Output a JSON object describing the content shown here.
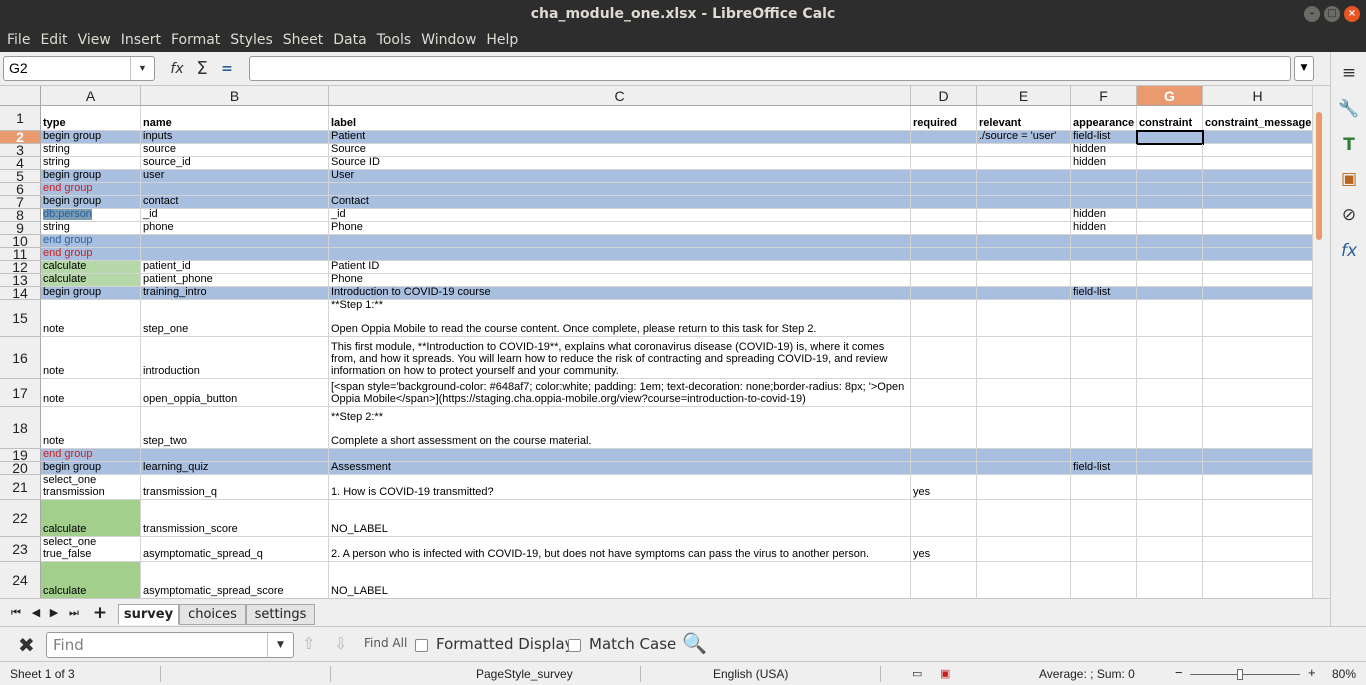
{
  "window": {
    "title": "cha_module_one.xlsx - LibreOffice Calc",
    "minimize": "–",
    "maximize": "□",
    "close": "×"
  },
  "menu": [
    "File",
    "Edit",
    "View",
    "Insert",
    "Format",
    "Styles",
    "Sheet",
    "Data",
    "Tools",
    "Window",
    "Help"
  ],
  "formula_bar": {
    "cell_ref": "G2",
    "content": ""
  },
  "columns": [
    {
      "id": "A",
      "label": "A"
    },
    {
      "id": "B",
      "label": "B"
    },
    {
      "id": "C",
      "label": "C"
    },
    {
      "id": "D",
      "label": "D"
    },
    {
      "id": "E",
      "label": "E"
    },
    {
      "id": "F",
      "label": "F"
    },
    {
      "id": "G",
      "label": "G",
      "selected": true
    },
    {
      "id": "H",
      "label": "H"
    }
  ],
  "rows": [
    {
      "num": "1",
      "cells": [
        "type",
        "name",
        "label",
        "required",
        "relevant",
        "appearance",
        "constraint",
        "constraint_message"
      ]
    },
    {
      "num": "2",
      "cells": [
        "begin group",
        "inputs",
        "Patient",
        "",
        "./source = 'user'",
        "field-list",
        "",
        ""
      ],
      "selected": true
    },
    {
      "num": "3",
      "cells": [
        "string",
        "source",
        "Source",
        "",
        "",
        "hidden",
        "",
        ""
      ]
    },
    {
      "num": "4",
      "cells": [
        "string",
        "source_id",
        "Source ID",
        "",
        "",
        "hidden",
        "",
        ""
      ]
    },
    {
      "num": "5",
      "cells": [
        "begin group",
        "user",
        "User",
        "",
        "",
        "",
        "",
        ""
      ]
    },
    {
      "num": "6",
      "cells": [
        "end group",
        "",
        "",
        "",
        "",
        "",
        "",
        ""
      ]
    },
    {
      "num": "7",
      "cells": [
        "begin group",
        "contact",
        "Contact",
        "",
        "",
        "",
        "",
        ""
      ]
    },
    {
      "num": "8",
      "cells": [
        "db:person",
        "_id",
        "_id",
        "",
        "",
        "hidden",
        "",
        ""
      ]
    },
    {
      "num": "9",
      "cells": [
        "string",
        "phone",
        "Phone",
        "",
        "",
        "hidden",
        "",
        ""
      ]
    },
    {
      "num": "10",
      "cells": [
        "end group",
        "",
        "",
        "",
        "",
        "",
        "",
        ""
      ]
    },
    {
      "num": "11",
      "cells": [
        "end group",
        "",
        "",
        "",
        "",
        "",
        "",
        ""
      ]
    },
    {
      "num": "12",
      "cells": [
        "calculate",
        "patient_id",
        "Patient ID",
        "",
        "",
        "",
        "",
        ""
      ]
    },
    {
      "num": "13",
      "cells": [
        "calculate",
        "patient_phone",
        "Phone",
        "",
        "",
        "",
        "",
        ""
      ]
    },
    {
      "num": "14",
      "cells": [
        "begin group",
        "training_intro",
        "Introduction to COVID-19 course",
        "",
        "",
        "field-list",
        "",
        ""
      ]
    },
    {
      "num": "15",
      "cells": [
        "note",
        "step_one",
        "**Step 1:**\n\nOpen Oppia Mobile to read the course content. Once complete, please return to this task for Step 2.",
        "",
        "",
        "",
        "",
        ""
      ]
    },
    {
      "num": "16",
      "cells": [
        "note",
        "introduction",
        "This first module, **Introduction to COVID-19**, explains what coronavirus disease (COVID-19) is, where it comes from, and how it spreads. You will learn how to reduce the risk of contracting and spreading COVID-19, and review information on how to protect yourself and your community.",
        "",
        "",
        "",
        "",
        ""
      ]
    },
    {
      "num": "17",
      "cells": [
        "note",
        "open_oppia_button",
        "[<span style='background-color: #648af7; color:white; padding: 1em; text-decoration: none;border-radius: 8px; '>Open Oppia Mobile</span>](https://staging.cha.oppia-mobile.org/view?course=introduction-to-covid-19)",
        "",
        "",
        "",
        "",
        ""
      ]
    },
    {
      "num": "18",
      "cells": [
        "note",
        "step_two",
        "**Step 2:**\n\nComplete a short assessment on the course material.",
        "",
        "",
        "",
        "",
        ""
      ]
    },
    {
      "num": "19",
      "cells": [
        "end group",
        "",
        "",
        "",
        "",
        "",
        "",
        ""
      ]
    },
    {
      "num": "20",
      "cells": [
        "begin group",
        "learning_quiz",
        "Assessment",
        "",
        "",
        "field-list",
        "",
        ""
      ]
    },
    {
      "num": "21",
      "cells": [
        "select_one transmission",
        "transmission_q",
        "1. How is COVID-19 transmitted?",
        "yes",
        "",
        "",
        "",
        ""
      ]
    },
    {
      "num": "22",
      "cells": [
        "calculate",
        "transmission_score",
        "NO_LABEL",
        "",
        "",
        "",
        "",
        ""
      ]
    },
    {
      "num": "23",
      "cells": [
        "select_one true_false",
        "asymptomatic_spread_q",
        "2. A person who is infected with COVID-19, but does not have symptoms can pass the virus to another person.",
        "yes",
        "",
        "",
        "",
        ""
      ]
    },
    {
      "num": "24",
      "cells": [
        "calculate",
        "asymptomatic_spread_score",
        "NO_LABEL",
        "",
        "",
        "",
        "",
        ""
      ]
    }
  ],
  "colors": {
    "group_row_bg": "#a9bfe0",
    "calc_bg": "#b6d7a8",
    "calc_dark_bg": "#a3cf8d",
    "end_group_text": "#c9211e",
    "blue_text": "#2a6099",
    "dbperson_bg": "#7a9cb4",
    "accent": "#e99a6f"
  },
  "sheets": [
    {
      "name": "survey",
      "active": true
    },
    {
      "name": "choices",
      "active": false
    },
    {
      "name": "settings",
      "active": false
    }
  ],
  "findbar": {
    "placeholder": "Find",
    "find_all": "Find All",
    "formatted_display": "Formatted Display",
    "match_case": "Match Case"
  },
  "status": {
    "sheet": "Sheet 1 of 3",
    "page_style": "PageStyle_survey",
    "language": "English (USA)",
    "summary": "Average: ; Sum: 0",
    "zoom": "80%"
  },
  "sidebar_icons": [
    "menu-icon",
    "properties-icon",
    "styles-icon",
    "gallery-icon",
    "navigator-icon",
    "functions-icon"
  ]
}
